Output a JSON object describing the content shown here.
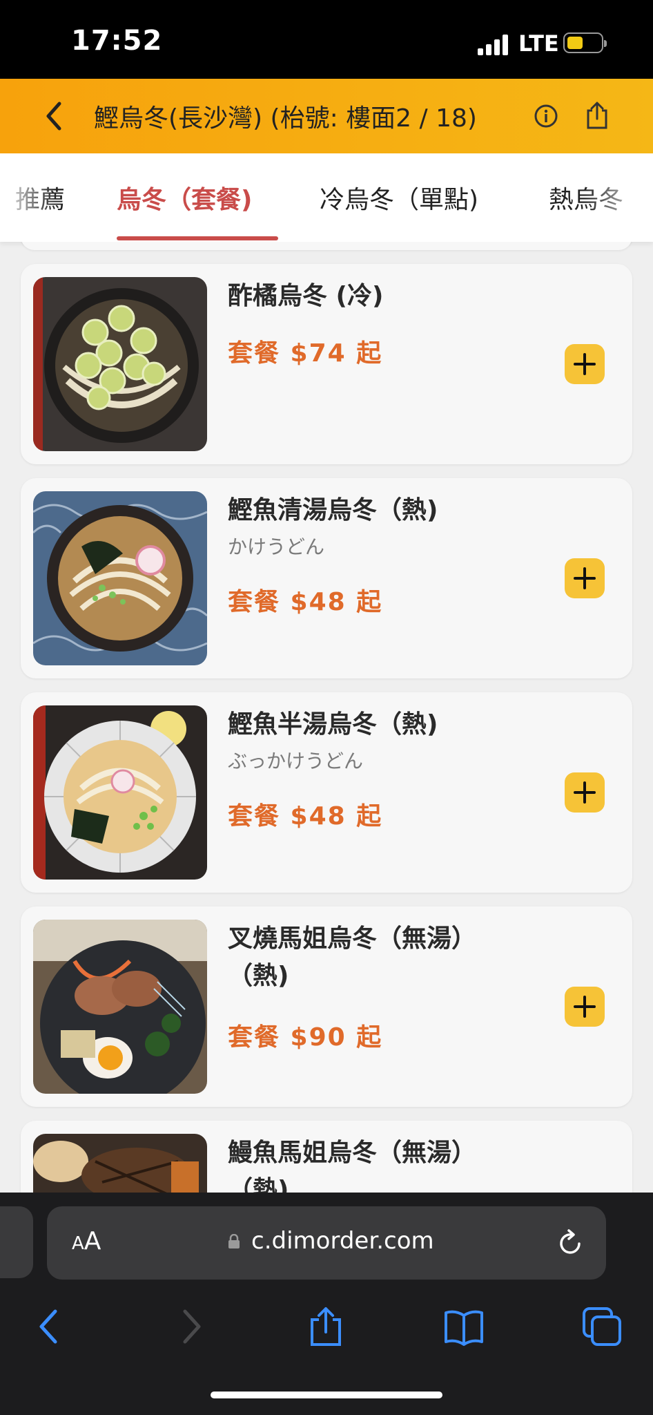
{
  "status_bar": {
    "time": "17:52",
    "network": "LTE"
  },
  "header": {
    "title": "鰹烏冬(長沙灣) (枱號: 樓面2 / 18)"
  },
  "tabs": [
    {
      "label": "推薦"
    },
    {
      "label": "烏冬（套餐)"
    },
    {
      "label": "冷烏冬（單點)"
    },
    {
      "label": "熱烏冬"
    }
  ],
  "menu_items": [
    {
      "name": "酢橘烏冬 (冷)",
      "subtitle": "",
      "price": "套餐 $74 起"
    },
    {
      "name": "鰹魚清湯烏冬（熱)",
      "subtitle": "かけうどん",
      "price": "套餐 $48 起"
    },
    {
      "name": "鰹魚半湯烏冬（熱)",
      "subtitle": "ぶっかけうどん",
      "price": "套餐 $48 起"
    },
    {
      "name": "叉燒馬姐烏冬（無湯）（熱)",
      "subtitle": "",
      "price": "套餐 $90 起"
    },
    {
      "name": "鰻魚馬姐烏冬（無湯）（熱)",
      "subtitle": "",
      "price": ""
    }
  ],
  "browser": {
    "aa_label": "AA",
    "url": "c.dimorder.com"
  },
  "colors": {
    "header_accent": "#f5a90f",
    "active_tab": "#c94c4a",
    "price": "#e06a2a",
    "add_button": "#f6c337"
  },
  "icons": [
    "back-chevron-icon",
    "info-icon",
    "share-icon",
    "plus-icon",
    "lock-icon",
    "reload-icon",
    "safari-back-icon",
    "safari-forward-icon",
    "safari-share-icon",
    "bookmarks-icon",
    "tabs-icon"
  ]
}
